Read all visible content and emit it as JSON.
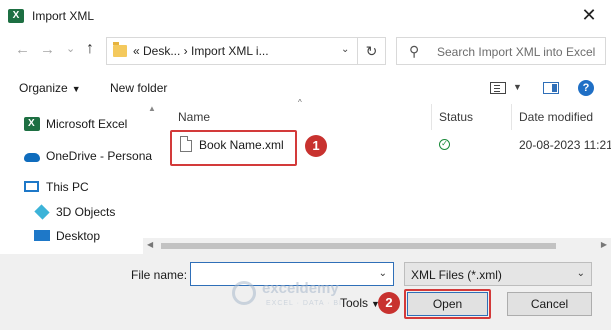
{
  "window": {
    "title": "Import XML",
    "close_glyph": "✕"
  },
  "nav": {
    "back_glyph": "←",
    "forward_glyph": "→",
    "recent_glyph": "⌄",
    "up_glyph": "↑",
    "address": {
      "crumbs": "«  Desk...  ›  Import XML i...",
      "dropdown_glyph": "⌄",
      "refresh_glyph": "↻"
    },
    "search": {
      "placeholder": "Search Import XML into Excel",
      "icon": "search-icon",
      "icon_glyph": "⚲"
    }
  },
  "toolbar": {
    "organize_label": "Organize",
    "organize_caret": "▼",
    "new_folder_label": "New folder",
    "view_caret": "▼",
    "help_glyph": "?"
  },
  "sidebar": {
    "scroll_up_glyph": "▲",
    "items": [
      {
        "label": "Microsoft Excel",
        "icon": "excel-icon"
      },
      {
        "label": "OneDrive - Personal",
        "icon": "onedrive-icon"
      },
      {
        "label": "This PC",
        "icon": "this-pc-icon"
      },
      {
        "label": "3D Objects",
        "icon": "3d-objects-icon"
      },
      {
        "label": "Desktop",
        "icon": "desktop-icon"
      }
    ]
  },
  "file_list": {
    "sort_glyph": "^",
    "columns": [
      "Name",
      "Status",
      "Date modified"
    ],
    "files": [
      {
        "name": "Book Name.xml",
        "status": "synced",
        "status_glyph": "✓",
        "date_modified": "20-08-2023 11:21"
      }
    ],
    "scroll_left_glyph": "◀",
    "scroll_right_glyph": "▶"
  },
  "footer": {
    "file_name_label": "File name:",
    "file_name_value": "",
    "file_name_caret": "⌄",
    "file_type_value": "XML Files (*.xml)",
    "file_type_caret": "⌄",
    "tools_label": "Tools",
    "tools_caret": "▼",
    "open_label": "Open",
    "cancel_label": "Cancel"
  },
  "annotations": {
    "step1": "1",
    "step2": "2"
  },
  "watermark": {
    "name": "exceldemy",
    "tagline": "EXCEL · DATA · BI"
  },
  "colors": {
    "highlight": "#d33a3a",
    "accent": "#2f6fb8",
    "excel_green": "#1d6f42"
  }
}
